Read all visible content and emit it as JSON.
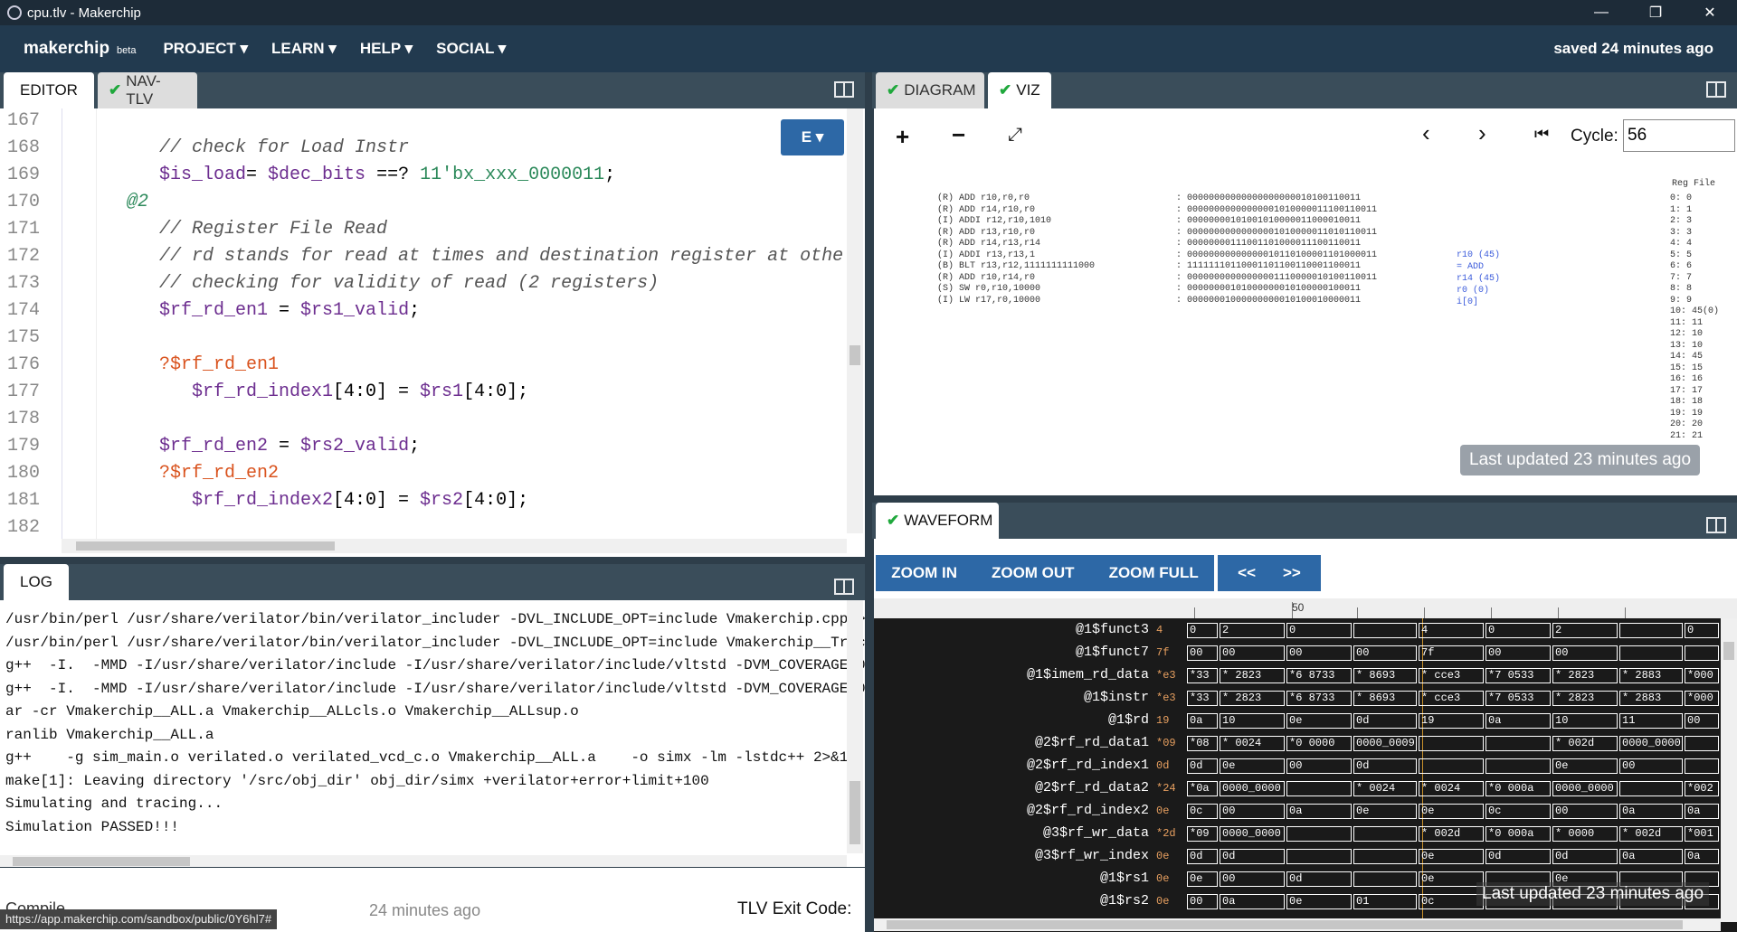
{
  "window": {
    "title": "cpu.tlv - Makerchip",
    "controls": [
      "—",
      "❐",
      "✕"
    ]
  },
  "nav": {
    "brand": "makerchip",
    "beta": "beta",
    "menu": [
      "PROJECT ▾",
      "LEARN ▾",
      "HELP ▾",
      "SOCIAL ▾"
    ],
    "saved": "saved 24 minutes ago"
  },
  "editor": {
    "tabs": [
      "EDITOR",
      "NAV-TLV"
    ],
    "mode_button": "E ▾",
    "lines": [
      {
        "n": "167",
        "parts": []
      },
      {
        "n": "168",
        "parts": [
          [
            "cmt",
            "// check for Load Instr"
          ]
        ]
      },
      {
        "n": "169",
        "parts": [
          [
            "var",
            "$is_load"
          ],
          [
            "",
            "= "
          ],
          [
            "var",
            "$dec_bits"
          ],
          [
            "",
            " ==? "
          ],
          [
            "kw",
            "11'bx_xxx_0000011"
          ],
          [
            "",
            ";"
          ]
        ]
      },
      {
        "n": "170",
        "parts": [
          [
            "pipe",
            "@2"
          ]
        ]
      },
      {
        "n": "171",
        "parts": [
          [
            "cmt",
            "// Register File Read"
          ]
        ]
      },
      {
        "n": "172",
        "parts": [
          [
            "cmt",
            "// rd stands for read at times and destination register at othe"
          ]
        ]
      },
      {
        "n": "173",
        "parts": [
          [
            "cmt",
            "// checking for validity of read (2 registers)"
          ]
        ]
      },
      {
        "n": "174",
        "parts": [
          [
            "var",
            "$rf_rd_en1"
          ],
          [
            "",
            " = "
          ],
          [
            "var",
            "$rs1_valid"
          ],
          [
            "",
            ";"
          ]
        ]
      },
      {
        "n": "175",
        "parts": []
      },
      {
        "n": "176",
        "parts": [
          [
            "when",
            "?$rf_rd_en1"
          ]
        ]
      },
      {
        "n": "177",
        "parts": [
          [
            "var",
            "   $rf_rd_index1"
          ],
          [
            "",
            "[4:0] = "
          ],
          [
            "var",
            "$rs1"
          ],
          [
            "",
            "[4:0];"
          ]
        ]
      },
      {
        "n": "178",
        "parts": []
      },
      {
        "n": "179",
        "parts": [
          [
            "var",
            "$rf_rd_en2"
          ],
          [
            "",
            " = "
          ],
          [
            "var",
            "$rs2_valid"
          ],
          [
            "",
            ";"
          ]
        ]
      },
      {
        "n": "180",
        "parts": [
          [
            "when",
            "?$rf_rd_en2"
          ]
        ]
      },
      {
        "n": "181",
        "parts": [
          [
            "var",
            "   $rf_rd_index2"
          ],
          [
            "",
            "[4:0] = "
          ],
          [
            "var",
            "$rs2"
          ],
          [
            "",
            "[4:0];"
          ]
        ]
      },
      {
        "n": "182",
        "parts": []
      }
    ]
  },
  "log": {
    "tab": "LOG",
    "lines": [
      "/usr/bin/perl /usr/share/verilator/bin/verilator_includer -DVL_INCLUDE_OPT=include Vmakerchip.cpp >",
      "/usr/bin/perl /usr/share/verilator/bin/verilator_includer -DVL_INCLUDE_OPT=include Vmakerchip__Trac",
      "g++  -I.  -MMD -I/usr/share/verilator/include -I/usr/share/verilator/include/vltstd -DVM_COVERAGE=0",
      "g++  -I.  -MMD -I/usr/share/verilator/include -I/usr/share/verilator/include/vltstd -DVM_COVERAGE=0",
      "ar -cr Vmakerchip__ALL.a Vmakerchip__ALLcls.o Vmakerchip__ALLsup.o",
      "ranlib Vmakerchip__ALL.a",
      "g++    -g sim_main.o verilated.o verilated_vcd_c.o Vmakerchip__ALL.a    -o simx -lm -lstdc++ 2>&1 |",
      "make[1]: Leaving directory '/src/obj_dir' obj_dir/simx +verilator+error+limit+100",
      "Simulating and tracing...",
      "Simulation PASSED!!!"
    ],
    "status_compile": "Compile",
    "status_ago": "24 minutes ago",
    "status_exit": "TLV Exit Code:",
    "url": "https://app.makerchip.com/sandbox/public/0Y6hl7#"
  },
  "viz": {
    "tabs": [
      "DIAGRAM",
      "VIZ"
    ],
    "cycle_label": "Cycle:",
    "cycle_value": "56",
    "overlay": "Last updated 23 minutes ago",
    "disasm": [
      "(R) ADD r10,r0,r0",
      "(R) ADD r14,r10,r0",
      "(I) ADDI r12,r10,1010",
      "(R) ADD r13,r10,r0",
      "(R) ADD r14,r13,r14",
      "(I) ADDI r13,r13,1",
      "(B) BLT r13,r12,1111111111000",
      "(R) ADD r10,r14,r0",
      "(S) SW r0,r10,10000",
      "(I) LW r17,r0,10000"
    ],
    "binary": [
      ": 00000000000000000000010100110011",
      ": 00000000000000001010000011100110011",
      ": 00000000101001010000011000010011",
      ": 00000000000000001010000011010110011",
      ": 00000000111001101000011100110011",
      ": 00000000000000010110100001101000011",
      ": 11111110110001101100110001100011",
      ": 00000000000000001110000010100110011",
      ": 00000000101000000010100000100011",
      ": 00000001000000000010100010000011"
    ],
    "exec": [
      "r10 (45)",
      "= ADD",
      "r14 (45)",
      "r0 (0)",
      "i[0]"
    ],
    "regfile_title": "Reg File",
    "regfile": [
      "0: 0",
      "1: 1",
      "2: 3",
      "3: 3",
      "4: 4",
      "5: 5",
      "6: 6",
      "7: 7",
      "8: 8",
      "9: 9",
      "10: 45(0)",
      "11: 11",
      "12: 10",
      "13: 10",
      "14: 45",
      "15: 15",
      "16: 16",
      "17: 17",
      "18: 18",
      "19: 19",
      "20: 20",
      "21: 21"
    ]
  },
  "waveform": {
    "tab": "WAVEFORM",
    "buttons": [
      "ZOOM IN",
      "ZOOM OUT",
      "ZOOM FULL",
      "<<",
      ">>"
    ],
    "marker": "50",
    "overlay": "Last updated 23 minutes ago",
    "signals": [
      {
        "name": "@1$funct3",
        "v": "4",
        "cells": [
          "0",
          "2",
          "0",
          "",
          "4",
          "0",
          "2",
          "",
          "0"
        ]
      },
      {
        "name": "@1$funct7",
        "v": "7f",
        "cells": [
          "00",
          "00",
          "00",
          "00",
          "7f",
          "00",
          "00",
          "",
          ""
        ]
      },
      {
        "name": "@1$imem_rd_data",
        "v": "*e3",
        "cells": [
          "*33",
          "* 2823",
          "*6 8733",
          "* 8693",
          "* cce3",
          "*7 0533",
          "* 2823",
          "* 2883",
          "*000"
        ]
      },
      {
        "name": "@1$instr",
        "v": "*e3",
        "cells": [
          "*33",
          "* 2823",
          "*6 8733",
          "* 8693",
          "* cce3",
          "*7 0533",
          "* 2823",
          "* 2883",
          "*000"
        ]
      },
      {
        "name": "@1$rd",
        "v": "19",
        "cells": [
          "0a",
          "10",
          "0e",
          "0d",
          "19",
          "0a",
          "10",
          "11",
          "00"
        ]
      },
      {
        "name": "@2$rf_rd_data1",
        "v": "*09",
        "cells": [
          "*08",
          "* 0024",
          "*0 0000",
          "0000_0009",
          "",
          "",
          "* 002d",
          "0000_0000",
          ""
        ]
      },
      {
        "name": "@2$rf_rd_index1",
        "v": "0d",
        "cells": [
          "0d",
          "0e",
          "00",
          "0d",
          "",
          "",
          "0e",
          "00",
          ""
        ]
      },
      {
        "name": "@2$rf_rd_data2",
        "v": "*24",
        "cells": [
          "*0a",
          "0000_0000",
          "",
          "* 0024",
          "* 0024",
          "*0 000a",
          "0000_0000",
          "",
          "*002"
        ]
      },
      {
        "name": "@2$rf_rd_index2",
        "v": "0e",
        "cells": [
          "0c",
          "00",
          "0a",
          "0e",
          "0e",
          "0c",
          "00",
          "0a",
          "0a"
        ]
      },
      {
        "name": "@3$rf_wr_data",
        "v": "*2d",
        "cells": [
          "*09",
          "0000_0000",
          "",
          "",
          "* 002d",
          "*0 000a",
          "* 0000",
          "* 002d",
          "*001"
        ]
      },
      {
        "name": "@3$rf_wr_index",
        "v": "0e",
        "cells": [
          "0d",
          "0d",
          "",
          "",
          "0e",
          "0d",
          "0d",
          "0a",
          "0a"
        ]
      },
      {
        "name": "@1$rs1",
        "v": "0e",
        "cells": [
          "0e",
          "00",
          "0d",
          "",
          "0e",
          "",
          "0e",
          "",
          ""
        ]
      },
      {
        "name": "@1$rs2",
        "v": "0e",
        "cells": [
          "00",
          "0a",
          "0e",
          "01",
          "0c",
          "",
          "",
          "",
          ""
        ]
      }
    ]
  }
}
